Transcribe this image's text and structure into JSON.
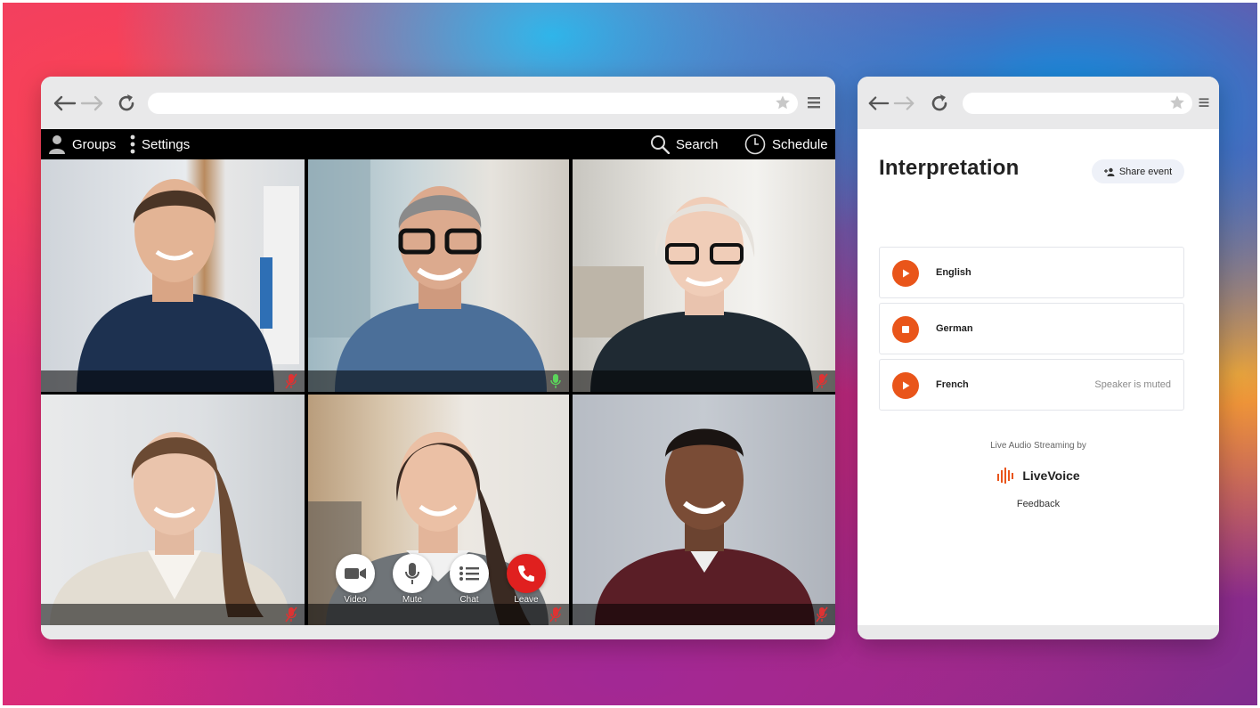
{
  "video_app": {
    "menu": {
      "groups_label": "Groups",
      "settings_label": "Settings",
      "search_label": "Search",
      "schedule_label": "Schedule"
    },
    "participants": [
      {
        "mic": "muted"
      },
      {
        "mic": "active"
      },
      {
        "mic": "muted"
      },
      {
        "mic": "muted"
      },
      {
        "mic": "muted"
      },
      {
        "mic": "muted"
      }
    ],
    "controls": {
      "video_label": "Video",
      "mute_label": "Mute",
      "chat_label": "Chat",
      "leave_label": "Leave"
    }
  },
  "interpretation": {
    "title": "Interpretation",
    "share_label": "Share event",
    "languages": [
      {
        "name": "English",
        "state": "play",
        "status": ""
      },
      {
        "name": "German",
        "state": "stop",
        "status": ""
      },
      {
        "name": "French",
        "state": "play",
        "status": "Speaker is muted"
      }
    ],
    "powered_by": "Live Audio Streaming by",
    "brand_name": "LiveVoice",
    "feedback_label": "Feedback"
  },
  "colors": {
    "accent_orange": "#e9551a",
    "mic_active": "#5bd45b",
    "mic_muted": "#d33",
    "leave_red": "#e0201f"
  }
}
